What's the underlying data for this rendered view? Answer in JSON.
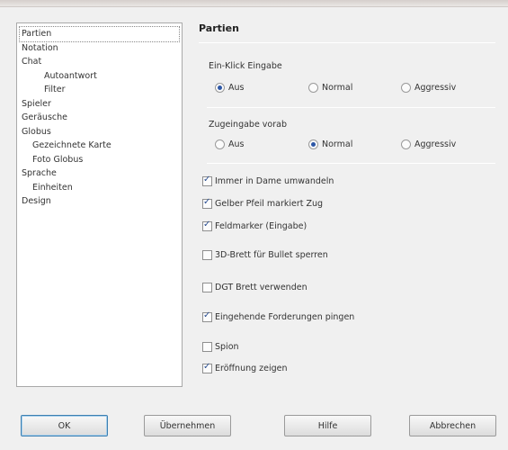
{
  "nav": {
    "items": [
      {
        "label": "Partien",
        "level": 0,
        "selected": true
      },
      {
        "label": "Notation",
        "level": 0
      },
      {
        "label": "Chat",
        "level": 0
      },
      {
        "label": "Autoantwort",
        "level": 2
      },
      {
        "label": "Filter",
        "level": 2
      },
      {
        "label": "Spieler",
        "level": 0
      },
      {
        "label": "Geräusche",
        "level": 0
      },
      {
        "label": "Globus",
        "level": 0
      },
      {
        "label": "Gezeichnete Karte",
        "level": 1
      },
      {
        "label": "Foto Globus",
        "level": 1
      },
      {
        "label": "Sprache",
        "level": 0
      },
      {
        "label": "Einheiten",
        "level": 1
      },
      {
        "label": "Design",
        "level": 0
      }
    ]
  },
  "panel": {
    "title": "Partien",
    "one_click": {
      "label": "Ein-Klick Eingabe",
      "options": [
        "Aus",
        "Normal",
        "Aggressiv"
      ],
      "selected": "Aus"
    },
    "premove": {
      "label": "Zugeingabe vorab",
      "options": [
        "Aus",
        "Normal",
        "Aggressiv"
      ],
      "selected": "Normal"
    },
    "checks": [
      {
        "label": "Immer in Dame umwandeln",
        "checked": true
      },
      {
        "label": "Gelber Pfeil markiert Zug",
        "checked": true
      },
      {
        "label": "Feldmarker (Eingabe)",
        "checked": true
      },
      {
        "label": "3D-Brett für Bullet sperren",
        "checked": false
      },
      {
        "label": "DGT Brett verwenden",
        "checked": false
      },
      {
        "label": "Eingehende Forderungen pingen",
        "checked": true
      },
      {
        "label": "Spion",
        "checked": false
      },
      {
        "label": "Eröffnung zeigen",
        "checked": true
      }
    ]
  },
  "buttons": {
    "ok": "OK",
    "apply": "Übernehmen",
    "help": "Hilfe",
    "cancel": "Abbrechen"
  }
}
